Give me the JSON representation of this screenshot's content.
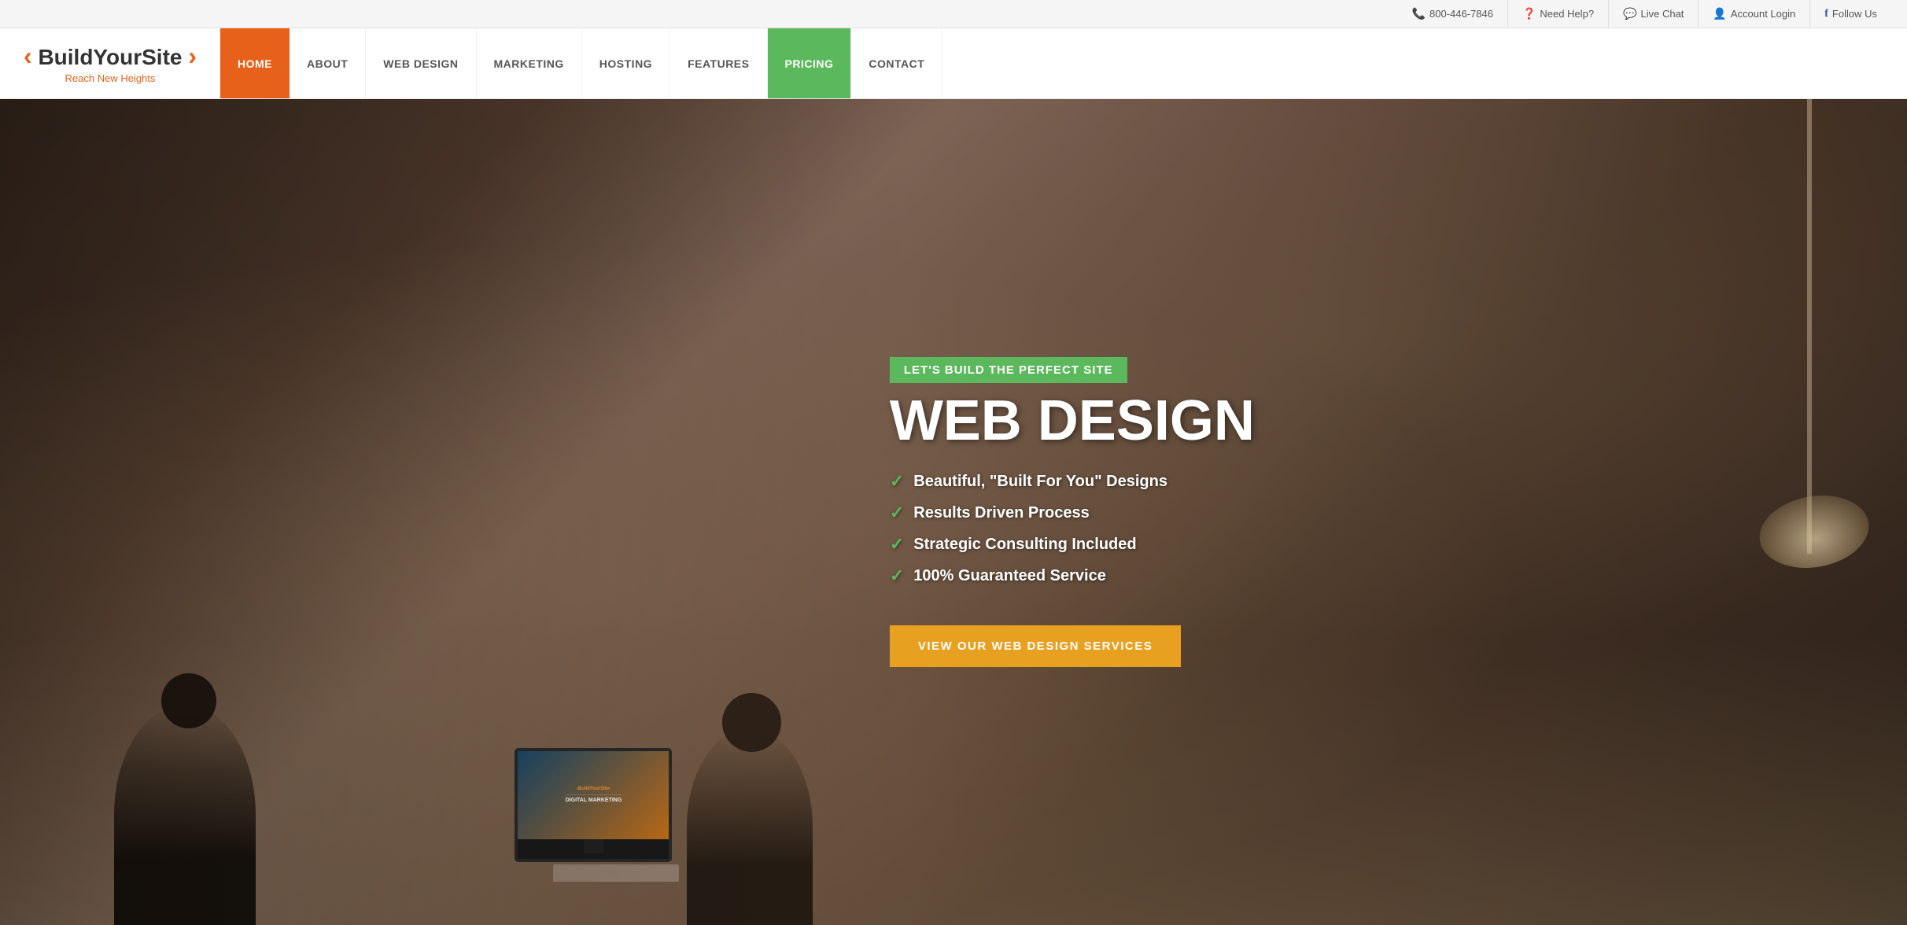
{
  "topbar": {
    "phone": {
      "icon": "📞",
      "number": "800-446-7846"
    },
    "help": {
      "icon": "❓",
      "label": "Need Help?"
    },
    "livechat": {
      "icon": "💬",
      "label": "Live Chat"
    },
    "account": {
      "icon": "👤",
      "label": "Account Login"
    },
    "follow": {
      "icon": "f",
      "label": "Follow Us"
    }
  },
  "logo": {
    "bracket_left": "‹",
    "name": "BuildYourSite",
    "bracket_right": "›",
    "tagline": "Reach New Heights"
  },
  "nav": {
    "items": [
      {
        "label": "HOME",
        "active": true
      },
      {
        "label": "ABOUT",
        "active": false
      },
      {
        "label": "WEB DESIGN",
        "active": false
      },
      {
        "label": "MARKETING",
        "active": false
      },
      {
        "label": "HOSTING",
        "active": false
      },
      {
        "label": "FEATURES",
        "active": false
      },
      {
        "label": "PRICING",
        "active": false,
        "special": "pricing"
      },
      {
        "label": "CONTACT",
        "active": false
      }
    ]
  },
  "hero": {
    "tag": "LET'S BUILD THE PERFECT SITE",
    "title": "WEB DESIGN",
    "features": [
      "Beautiful, \"Built For You\" Designs",
      "Results Driven Process",
      "Strategic Consulting Included",
      "100% Guaranteed Service"
    ],
    "cta_button": "VIEW OUR WEB DESIGN SERVICES"
  }
}
